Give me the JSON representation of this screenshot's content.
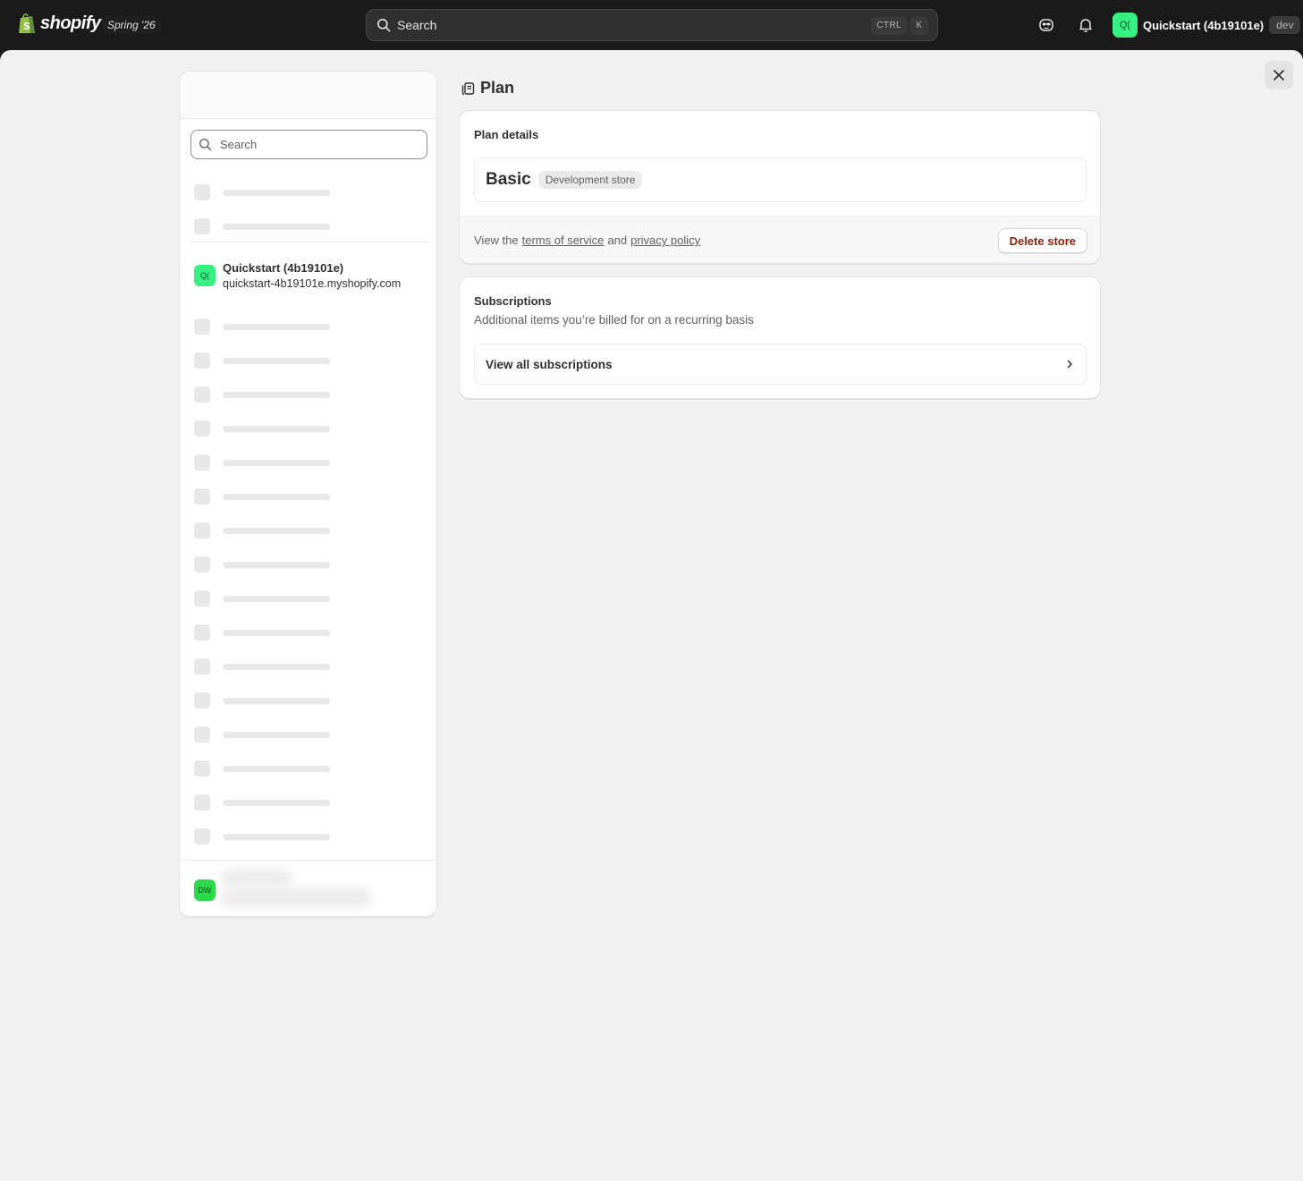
{
  "topbar": {
    "brand": "shopify",
    "release": "Spring '26",
    "search_placeholder": "Search",
    "shortcut_keys": [
      "CTRL",
      "K"
    ],
    "account": {
      "initials": "Q(",
      "name": "Quickstart (4b19101e)",
      "tag": "dev"
    }
  },
  "sidebar": {
    "search_placeholder": "Search",
    "store": {
      "initials": "Q(",
      "name": "Quickstart (4b19101e)",
      "url": "quickstart-4b19101e.myshopify.com"
    },
    "user": {
      "initials": "DW"
    }
  },
  "page": {
    "title": "Plan"
  },
  "plan_card": {
    "title": "Plan details",
    "plan_name": "Basic",
    "plan_badge": "Development store",
    "footer_prefix": "View the",
    "terms_link": "terms of service",
    "footer_and": "and",
    "privacy_link": "privacy policy",
    "delete_label": "Delete store"
  },
  "subscriptions_card": {
    "title": "Subscriptions",
    "description": "Additional items you’re billed for on a recurring basis",
    "view_all_label": "View all subscriptions"
  },
  "colors": {
    "store_avatar": "#36f181",
    "user_avatar": "#2dd94a",
    "danger": "#8e1f0b"
  }
}
